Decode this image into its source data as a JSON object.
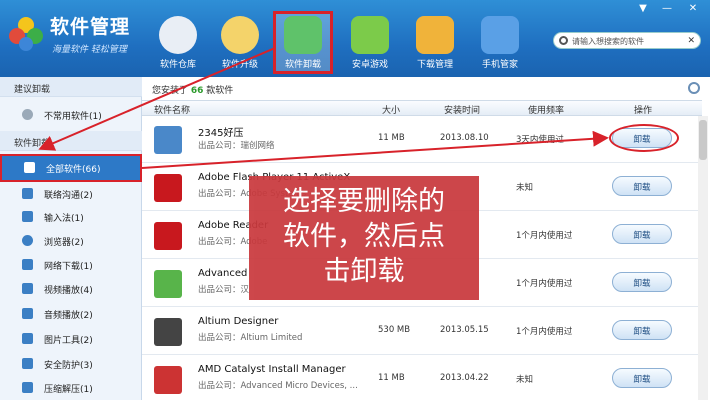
{
  "app": {
    "title": "软件管理",
    "subtitle": "海量软件 轻松管理"
  },
  "window_controls": [
    "▼",
    "—",
    "✕"
  ],
  "toolbar": [
    {
      "label": "软件仓库",
      "color": "#e9eef5",
      "icon": "disc-icon"
    },
    {
      "label": "软件升级",
      "color": "#f4d36a",
      "icon": "upgrade-icon"
    },
    {
      "label": "软件卸载",
      "color": "#5fc26a",
      "icon": "recycle-bin-icon",
      "active": true
    },
    {
      "label": "安卓游戏",
      "color": "#7ccb4a",
      "icon": "android-icon"
    },
    {
      "label": "下载管理",
      "color": "#f0b33a",
      "icon": "download-icon"
    },
    {
      "label": "手机管家",
      "color": "#5aa0e6",
      "icon": "shield-icon"
    }
  ],
  "search": {
    "placeholder": "请输入想搜索的软件",
    "go": "✕"
  },
  "sidebar": {
    "section1": "建议卸载",
    "uncommon": "不常用软件(1)",
    "section2": "软件卸载",
    "items": [
      {
        "label": "全部软件(66)",
        "active": true,
        "icon": "grid-icon"
      },
      {
        "label": "联络沟通(2)",
        "icon": "chat-icon"
      },
      {
        "label": "输入法(1)",
        "icon": "keyboard-icon"
      },
      {
        "label": "浏览器(2)",
        "icon": "browser-icon"
      },
      {
        "label": "网络下载(1)",
        "icon": "download-icon"
      },
      {
        "label": "视频播放(4)",
        "icon": "video-icon"
      },
      {
        "label": "音频播放(2)",
        "icon": "music-icon"
      },
      {
        "label": "图片工具(2)",
        "icon": "image-icon"
      },
      {
        "label": "安全防护(3)",
        "icon": "shield-icon"
      },
      {
        "label": "压缩解压(1)",
        "icon": "archive-icon"
      }
    ]
  },
  "main": {
    "summary_prefix": "您安装了",
    "summary_count": "66",
    "summary_suffix": "款软件",
    "columns": {
      "name": "软件名称",
      "size": "大小",
      "date": "安装时间",
      "freq": "使用频率",
      "action": "操作"
    },
    "rows": [
      {
        "name": "2345好压",
        "pub": "出品公司：瑞创网络",
        "size": "11 MB",
        "date": "2013.08.10",
        "freq": "3天内使用过",
        "action": "卸载",
        "color": "#4a88c9"
      },
      {
        "name": "Adobe Flash Player 11 ActiveX",
        "pub": "出品公司：Adobe Systems",
        "size": "",
        "date": "",
        "freq": "未知",
        "action": "卸载",
        "color": "#c8181e"
      },
      {
        "name": "Adobe Reader",
        "pub": "出品公司：Adobe",
        "size": "",
        "date": "",
        "freq": "1个月内使用过",
        "action": "卸载",
        "color": "#c8181e"
      },
      {
        "name": "Advanced",
        "pub": "出品公司：汉",
        "size": "",
        "date": "",
        "freq": "1个月内使用过",
        "action": "卸载",
        "color": "#58b44a"
      },
      {
        "name": "Altium Designer",
        "pub": "出品公司：Altium Limited",
        "size": "530 MB",
        "date": "2013.05.15",
        "freq": "1个月内使用过",
        "action": "卸载",
        "color": "#444444"
      },
      {
        "name": "AMD Catalyst Install Manager",
        "pub": "出品公司：Advanced Micro Devices, ...",
        "size": "11 MB",
        "date": "2013.04.22",
        "freq": "未知",
        "action": "卸载",
        "color": "#cc3333"
      }
    ]
  },
  "overlay": {
    "line1": "选择要删除的",
    "line2": "软件，然后点",
    "line3": "击卸载"
  }
}
